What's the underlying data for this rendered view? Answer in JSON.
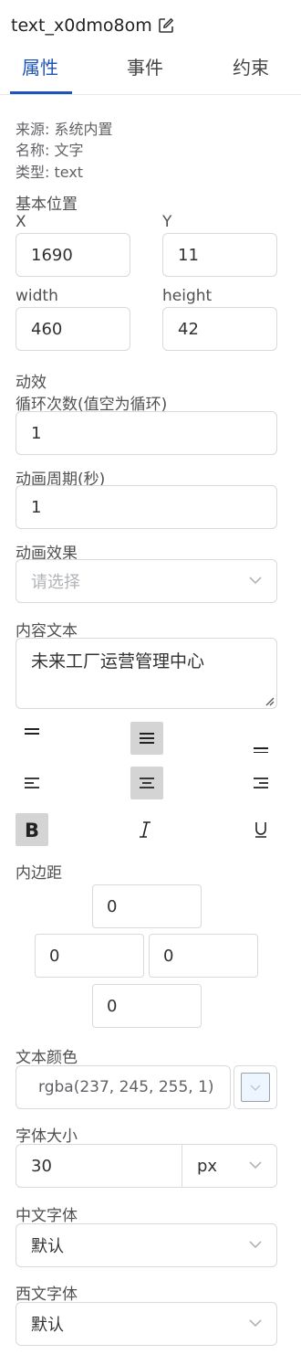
{
  "component": {
    "name": "text_x0dmo8om"
  },
  "tabs": [
    {
      "label": "属性",
      "active": true
    },
    {
      "label": "事件",
      "active": false
    },
    {
      "label": "约束",
      "active": false
    }
  ],
  "info": {
    "source": "来源: 系统内置",
    "name": "名称: 文字",
    "type": "类型: text"
  },
  "position": {
    "section_label": "基本位置",
    "x_label": "X",
    "y_label": "Y",
    "x": "1690",
    "y": "11",
    "width_label": "width",
    "height_label": "height",
    "width": "460",
    "height": "42"
  },
  "animation": {
    "section_label": "动效",
    "loop_label": "循环次数(值空为循环)",
    "loop_value": "1",
    "period_label": "动画周期(秒)",
    "period_value": "1",
    "effect_label": "动画效果",
    "effect_placeholder": "请选择"
  },
  "content": {
    "label": "内容文本",
    "text": "未来工厂运营管理中心"
  },
  "vertical_align": {
    "selected": "middle"
  },
  "horizontal_align": {
    "selected": "center"
  },
  "font_style": {
    "bold": true,
    "italic": false,
    "underline": false
  },
  "padding": {
    "label": "内边距",
    "top": "0",
    "left": "0",
    "right": "0",
    "bottom": "0"
  },
  "text_color": {
    "label": "文本颜色",
    "value": "rgba(237, 245, 255, 1)",
    "swatch": "#edf5ff"
  },
  "font_size": {
    "label": "字体大小",
    "value": "30",
    "unit": "px"
  },
  "cn_font": {
    "label": "中文字体",
    "value": "默认"
  },
  "en_font": {
    "label": "西文字体",
    "value": "默认"
  },
  "colors": {
    "accent": "#1f54b8",
    "border": "#d6d9de",
    "active_btn": "#d4d4d4"
  }
}
